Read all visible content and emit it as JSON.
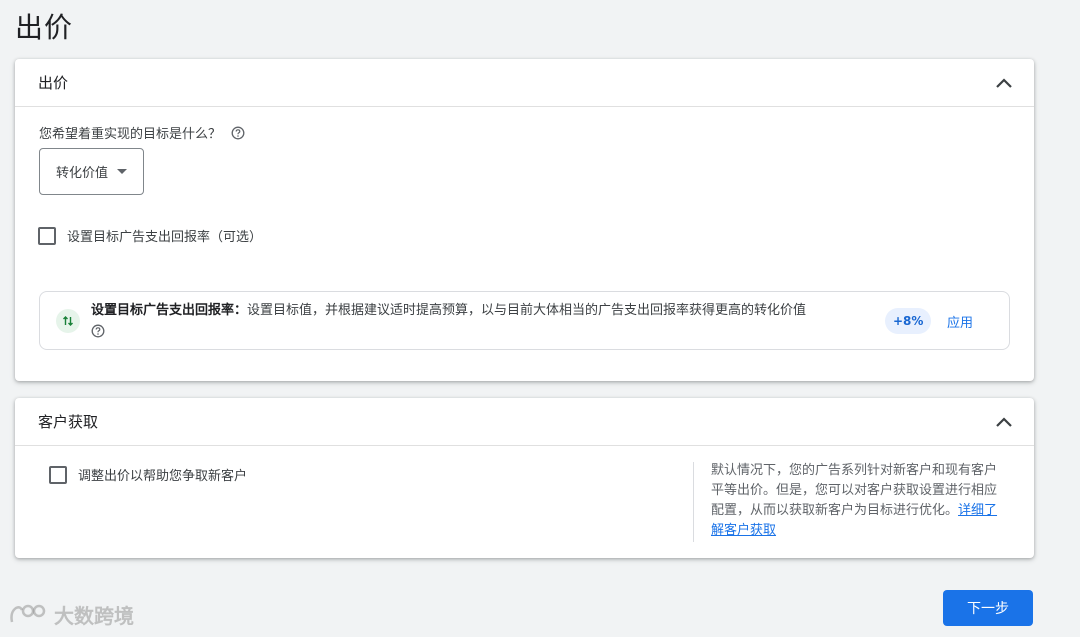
{
  "page": {
    "title": "出价"
  },
  "bidding": {
    "header_title": "出价",
    "question": "您希望着重实现的目标是什么？",
    "dropdown_value": "转化价值",
    "troas_checkbox_label": "设置目标广告支出回报率（可选）",
    "recommendation": {
      "title": "设置目标广告支出回报率：",
      "body": "设置目标值，并根据建议适时提高预算，以与目前大体相当的广告支出回报率获得更高的转化价值",
      "badge": "+8%",
      "apply_label": "应用"
    }
  },
  "acquisition": {
    "header_title": "客户获取",
    "checkbox_label": "调整出价以帮助您争取新客户",
    "description": "默认情况下，您的广告系列针对新客户和现有客户平等出价。但是，您可以对客户获取设置进行相应配置，从而以获取新客户为目标进行优化。",
    "learn_more": "详细了解客户获取"
  },
  "footer": {
    "next_label": "下一步"
  },
  "watermark": {
    "text": "大数跨境"
  },
  "colors": {
    "primary": "#1a73e8",
    "badge_bg": "#e8f0fe",
    "reco_icon_bg": "#e6f4ea",
    "reco_icon": "#188038"
  }
}
